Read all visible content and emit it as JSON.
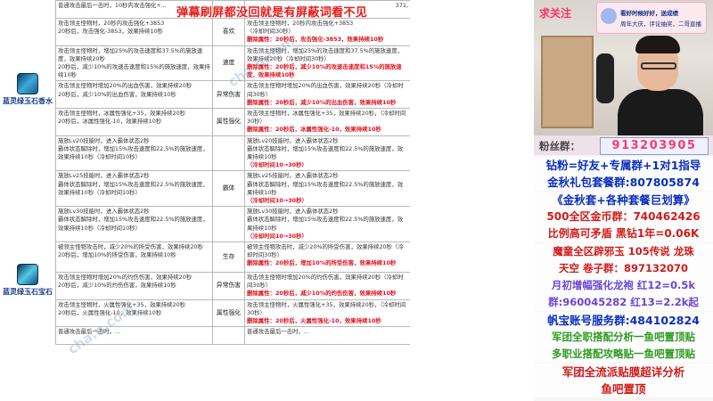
{
  "banner": "弹幕刷屏都没回就是有屏蔽词看不见",
  "watermark": "cha.n.com",
  "gems": [
    {
      "name": "蓝灵绿玉石香水"
    },
    {
      "name": "蓝灵绿玉石宝石"
    }
  ],
  "rows": [
    {
      "left": "普通攻击最后一击时，10秒内攻击强化+...",
      "mid": "",
      "right": "",
      "right_red": "",
      "right_tail": "371,"
    },
    {
      "left": "攻击领主怪物时，20秒内攻击强化+3853\n20秒后，攻击强化-3853，效果持续10秒",
      "mid": "喜欢",
      "right": "攻击领主怪物时，20秒内攻击强化+3853\n（冷却时间30秒）",
      "right_red": "删除属性：20秒后，攻击强化-3853，效果持续10秒"
    },
    {
      "left": "攻击领主怪物时，增加25%的攻击速度和37.5%的施放速度，效果持续20秒\n20秒后，减少10%的攻速击速度和15%的施放速度，效果持续10秒",
      "mid": "速度",
      "right": "攻击领主怪物时，增加25%的攻击速度和37.5%的施放速度，效果持续20秒（冷却时间30秒）",
      "right_red": "删除属性：20秒后，减少10%的攻速击速度和15%的施放速度，效果持续10秒"
    },
    {
      "left": "攻击领主怪物时增加20%的出血伤害，效果持续20秒\n20秒后，减少10%的出血伤害，效果持续10秒",
      "mid": "异常伤害",
      "right": "攻击领主怪物时增加20%的出血伤害，效果持续20秒（冷却时间30秒）",
      "right_red": "删除属性：20秒后，减少10%的出血伤害，效果持续10秒"
    },
    {
      "left": "攻击领主怪物时，冰属性强化+35，效果持续20秒\n20秒后，冰属性强化-10，效果持续10秒",
      "mid": "属性强化",
      "right": "攻击领主怪物时，冰属性强化+35，效果持续20秒，（冷却时间30秒）",
      "right_red": "删除属性：20秒后，冰属性强化-10，效果持续10秒"
    },
    {
      "left": "施放Lv20技能时，进入霸体状态2秒\n霸体状态解除时，增加15%攻击速度和22.5%的施放速度，效果持续10秒（冷却时间10秒）",
      "mid": "",
      "right": "施放Lv20技能时，进入霸体状态2秒\n霸体状态解除时，增加15%攻击速度和22.5%的施放速度，效果持续10秒",
      "right_red": "（冷却时间10→30秒）"
    },
    {
      "left": "施放Lv25技能时，进入霸体状态2秒\n霸体状态解除时，增加15%攻击速度和22.5%的施放速度，效果持续10秒（冷却时间10秒）",
      "mid": "霸体",
      "right": "施放Lv25技能时，进入霸体状态2秒\n霸体状态解除时，增加15%攻击速度和22.5%的施放速度，效果持续10秒",
      "right_red": "（冷却时间10→30秒）"
    },
    {
      "left": "施放Lv30技能时，进入霸体状态2秒\n霸体状态解除时，增加15%攻击速度和22.5%的施放速度，效果持续10秒（冷却时间10秒）",
      "mid": "",
      "right": "施放Lv30技能时，进入霸体状态2秒\n霸体状态解除时，增加15%攻击速度和22.5%的施放速度，效果持续10秒",
      "right_red": "（冷却时间10→30秒）"
    },
    {
      "left": "被领主怪物攻击时，减少20%的所受伤害，效果持续20秒\n20秒后，增加10%的所受伤害，效果持续10秒",
      "mid": "生存",
      "right": "被领主怪物攻击时，减少20%的所受伤害，效果持续20秒（冷却时间30秒）",
      "right_red": "删除属性：20秒后，增加10%的所受伤害，效果持续10秒"
    },
    {
      "left": "攻击领主怪物时增加20%的灼伤伤害，效果持续20秒\n20秒后，减少10%的灼伤伤害，效果持续10秒",
      "mid": "异常伤害",
      "right": "攻击领主怪物时增加20%的灼伤伤害，效果持续20秒（冷却时间30秒）",
      "right_red": "删除属性：20秒后，减少10%的灼伤伤害，效果持续10秒"
    },
    {
      "left": "攻击领主怪物时，火属性强化+35，效果持续20秒\n20秒后，火属性强化-10，效果持续10秒",
      "mid": "属性强化",
      "right": "攻击领主怪物时，火属性强化+35，效果持续20秒，（冷却时间30秒）",
      "right_red": "删除属性：20秒后，火属性强化-10，效果持续10秒"
    },
    {
      "left": "普通攻击最后一击时，...",
      "mid": "",
      "right": "普通攻击最后一击时，...",
      "right_red": ""
    }
  ],
  "stream": {
    "follow": "求关注",
    "badge_l1": "看好时候好好，送成绩",
    "badge_l2": "周年大庆，评论抽奖，二哥直播",
    "fans_label": "粉丝群：",
    "fans_number": "913203905",
    "lines": [
      {
        "text": "钻粉=好友+专属群+1对1指导",
        "color": "#0a2fbf",
        "bg": "#fdfdfd",
        "size": 12.5
      },
      {
        "text": "金秋礼包套餐群:807805874",
        "color": "#0a2fbf",
        "bg": "#fdfdfd",
        "size": 12.5
      },
      {
        "text": "《金秋套+各种套餐巨划算》",
        "color": "#0a2fbf",
        "bg": "#fdfdfd",
        "size": 12.5
      },
      {
        "text": "500全区金币群：740462426",
        "color": "#d21a1a",
        "bg": "#fdfdfd",
        "size": 12
      },
      {
        "text": "比例高可矛盾 黑钻1年=0.06K",
        "color": "#d21a1a",
        "bg": "#fdfdfd",
        "size": 12
      },
      {
        "text": "魔童全区辟邪玉 105传说 龙珠",
        "color": "#d21a1a",
        "bg": "#fdfdfd",
        "size": 11.5
      },
      {
        "text": "天空 卷子群：897132070",
        "color": "#d21a1a",
        "bg": "#fdfdfd",
        "size": 11.5
      },
      {
        "text": "月初增幅强化龙袍 红12=0.5k",
        "color": "#6a46d6",
        "bg": "#fdfdfd",
        "size": 11.5
      },
      {
        "text": "群:960045282 红13=2.2k起",
        "color": "#6a46d6",
        "bg": "#fdfdfd",
        "size": 11.5
      },
      {
        "text": "帆宝账号服务群:484102824",
        "color": "#0a2fbf",
        "bg": "#fdfdfd",
        "size": 12.5
      },
      {
        "text": "军团全职搭配分析一鱼吧置顶贴",
        "color": "#2c9a1f",
        "bg": "#fdfdfd",
        "size": 11.5
      },
      {
        "text": "多职业搭配攻略贴一鱼吧置顶贴",
        "color": "#2c9a1f",
        "bg": "#fdfdfd",
        "size": 11.5
      },
      {
        "text": "军团全流派贴膜超详分析",
        "color": "#d21a1a",
        "bg": "#fdfdfd",
        "size": 12.5
      },
      {
        "text": "鱼吧置顶",
        "color": "#d21a1a",
        "bg": "#fdfdfd",
        "size": 12.5
      }
    ]
  }
}
